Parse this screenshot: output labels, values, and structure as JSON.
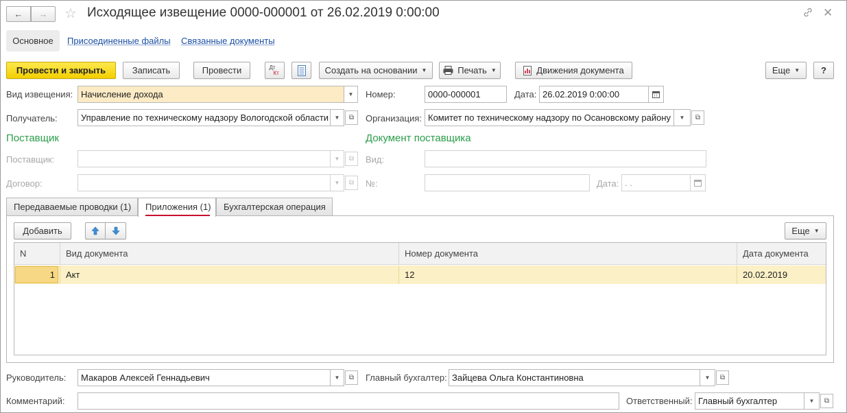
{
  "window": {
    "title": "Исходящее извещение 0000-000001 от 26.02.2019 0:00:00",
    "back_icon": "arrow-left-icon",
    "forward_icon": "arrow-right-icon",
    "favorite_icon": "star-icon",
    "link_icon": "link-icon",
    "close_icon": "close-icon"
  },
  "nav_tabs": [
    "Основное",
    "Присоединенные файлы",
    "Связанные документы"
  ],
  "toolbar": {
    "post_close": "Провести и закрыть",
    "save": "Записать",
    "post": "Провести",
    "dtkt_icon_top": "Дт",
    "dtkt_icon_bottom": "Кт",
    "create_based": "Создать на основании",
    "print": "Печать",
    "movements": "Движения документа",
    "more": "Еще",
    "help": "?"
  },
  "form": {
    "kind_label": "Вид извещения:",
    "kind_value": "Начисление дохода",
    "number_label": "Номер:",
    "number_value": "0000-000001",
    "date_label": "Дата:",
    "date_value": "26.02.2019  0:00:00",
    "recipient_label": "Получатель:",
    "recipient_value": "Управление по техническому надзору Вологодской области",
    "org_label": "Организация:",
    "org_value": "Комитет по техническому надзору по Осановскому району",
    "supplier_section": "Поставщик",
    "supplier_doc_section": "Документ поставщика",
    "supplier_label": "Поставщик:",
    "contract_label": "Договор:",
    "doc_kind_label": "Вид:",
    "doc_number_label": "№:",
    "doc_date_label": "Дата:",
    "doc_date_value": " .  ."
  },
  "form_tabs": [
    "Передаваемые проводки (1)",
    "Приложения (1)",
    "Бухгалтерская операция"
  ],
  "table_toolbar": {
    "add": "Добавить",
    "more": "Еще"
  },
  "table": {
    "columns": [
      "N",
      "Вид документа",
      "Номер документа",
      "Дата документа"
    ],
    "rows": [
      {
        "n": "1",
        "kind": "Акт",
        "number": "12",
        "date": "20.02.2019"
      }
    ]
  },
  "footer": {
    "head_label": "Руководитель:",
    "head_value": "Макаров Алексей Геннадьевич",
    "accountant_label": "Главный бухгалтер:",
    "accountant_value": "Зайцева Ольга Константиновна",
    "comment_label": "Комментарий:",
    "comment_value": "",
    "responsible_label": "Ответственный:",
    "responsible_value": "Главный бухгалтер"
  },
  "colors": {
    "primary_button": "#f3cf00",
    "section_heading": "#2a9d4a",
    "selected_row": "#fbf0c6",
    "active_tab_underline": "#c8102e",
    "link": "#1a4fa3"
  }
}
